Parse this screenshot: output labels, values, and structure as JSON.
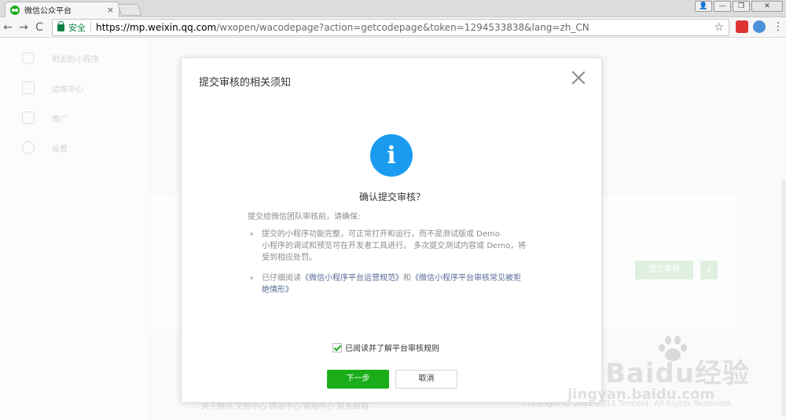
{
  "browser": {
    "tab_title": "微信公众平台",
    "tab_close": "×",
    "secure_label": "安全",
    "url_scheme_host": "https://mp.weixin.qq.com",
    "url_path": "/wxopen/wacodepage?action=getcodepage&token=1294533838&lang=zh_CN",
    "back": "←",
    "forward": "→",
    "reload": "C",
    "star": "☆",
    "menu": "⋮",
    "win_user": "👤",
    "win_min": "—",
    "win_max": "❐",
    "win_close": "✕"
  },
  "sidebar": {
    "items": [
      {
        "label": "附近的小程序",
        "icon": "location-icon"
      },
      {
        "label": "运维中心",
        "icon": "wrench-icon"
      },
      {
        "label": "推广",
        "icon": "megaphone-icon"
      },
      {
        "label": "设置",
        "icon": "gear-icon"
      }
    ]
  },
  "page": {
    "submit_label": "提交审核",
    "submit_dropdown": "∨",
    "footer_links": "关于腾讯   文档中心   辟谣中心   客服中心   联系邮箱",
    "copyright": "Copyright © 2012-2018 Tencent. All Rights Reserved."
  },
  "dialog": {
    "title": "提交审核的相关须知",
    "info_glyph": "i",
    "confirm_title": "确认提交审核？",
    "intro": "提交给微信团队审核前，请确保:",
    "bullet1_line1": "提交的小程序功能完整，可正常打开和运行，而不是测试版或 Demo",
    "bullet1_line2": "小程序的调试和预览可在开发者工具进行。 多次提交测试内容或 Demo，将",
    "bullet1_line3": "受到相应处罚。",
    "bullet2_prefix": "已仔细阅读",
    "bullet2_link1": "《微信小程序平台运营规范》",
    "bullet2_and": "和",
    "bullet2_link2_a": "《微信小程序平台审核常见被拒",
    "bullet2_link2_b": "绝情形》",
    "agree_label": "已阅读并了解平台审核规则",
    "next_button": "下一步",
    "cancel_button": "取消"
  },
  "watermark": {
    "brand": "Baidu经验",
    "sub": "jingyan.baidu.com"
  }
}
